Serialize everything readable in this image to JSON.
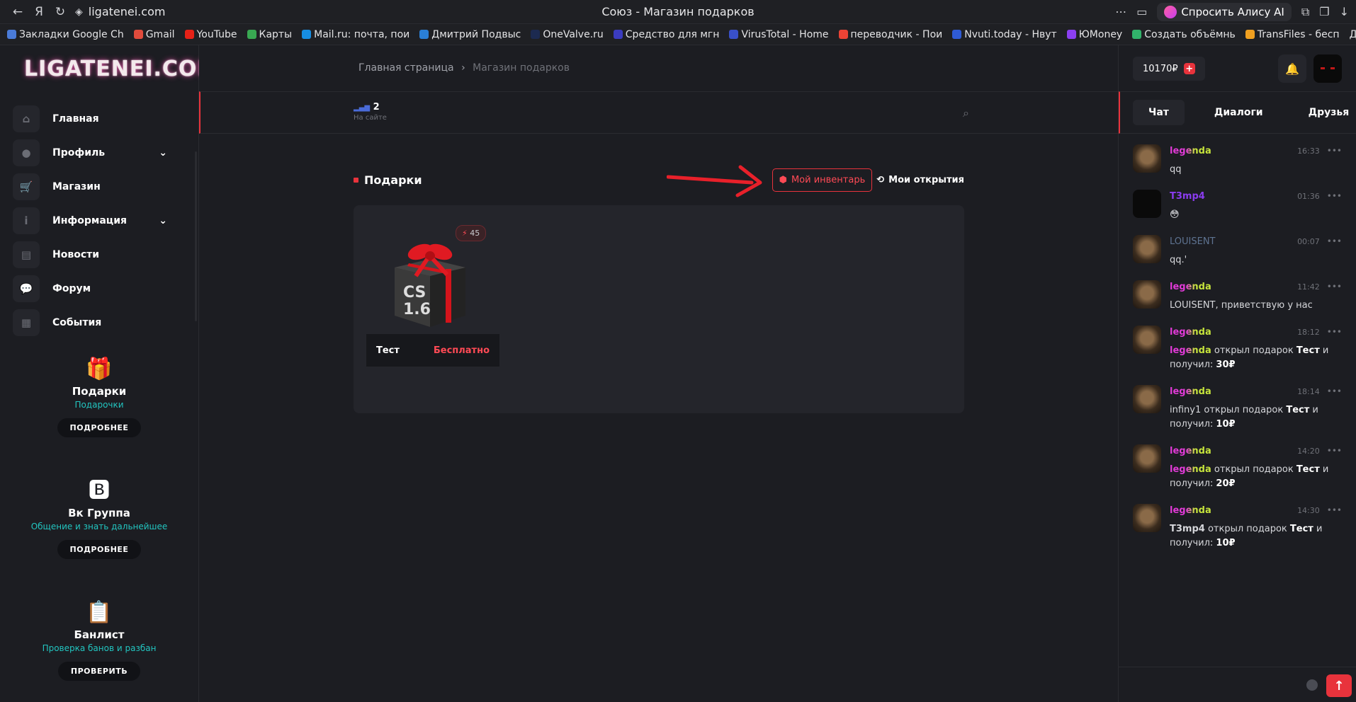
{
  "browser": {
    "url": "ligatenei.com",
    "tab_title": "Союз - Магазин подарков",
    "alice_label": "Спросить Алису AI",
    "bookmarks": [
      {
        "label": "Закладки Google Ch",
        "color": "#4a7bd8"
      },
      {
        "label": "Gmail",
        "color": "#e04b3c"
      },
      {
        "label": "YouTube",
        "color": "#e62117"
      },
      {
        "label": "Карты",
        "color": "#39a852"
      },
      {
        "label": "Mail.ru: почта, пои",
        "color": "#168de2"
      },
      {
        "label": "Дмитрий Подвыс",
        "color": "#2a7fd6"
      },
      {
        "label": "OneValve.ru",
        "color": "#1c2a50"
      },
      {
        "label": "Средство для мгн",
        "color": "#3b3cbf"
      },
      {
        "label": "VirusTotal - Home",
        "color": "#3950c8"
      },
      {
        "label": "переводчик - Пои",
        "color": "#ea4335"
      },
      {
        "label": "Nvuti.today - Нвут",
        "color": "#2f5bd6"
      },
      {
        "label": "ЮMoney",
        "color": "#8b3ff0"
      },
      {
        "label": "Создать объёмнь",
        "color": "#31b36b"
      },
      {
        "label": "TransFiles - бесп",
        "color": "#f0a020"
      }
    ],
    "other_bookmarks": "Другие закладки"
  },
  "site": {
    "logo": "LIGATENEI.COM",
    "menu": [
      {
        "label": "Главная",
        "icon": "home-icon",
        "glyph": "⌂",
        "chevron": false
      },
      {
        "label": "Профиль",
        "icon": "user-icon",
        "glyph": "●",
        "chevron": true
      },
      {
        "label": "Магазин",
        "icon": "cart-icon",
        "glyph": "🛒",
        "chevron": false
      },
      {
        "label": "Информация",
        "icon": "info-icon",
        "glyph": "i",
        "chevron": true
      },
      {
        "label": "Новости",
        "icon": "news-icon",
        "glyph": "▤",
        "chevron": false
      },
      {
        "label": "Форум",
        "icon": "forum-icon",
        "glyph": "💬",
        "chevron": false
      },
      {
        "label": "События",
        "icon": "calendar-icon",
        "glyph": "▦",
        "chevron": false
      }
    ],
    "promos": [
      {
        "title": "Подарки",
        "subtitle": "Подарочки",
        "button": "ПОДРОБНЕЕ",
        "icon": "gift-icon",
        "glyph": "🎁"
      },
      {
        "title": "Вк Группа",
        "subtitle": "Общение и знать дальнейшее",
        "button": "ПОДРОБНЕЕ",
        "icon": "vk-icon",
        "glyph": "🅱"
      },
      {
        "title": "Банлист",
        "subtitle": "Проверка банов и разбан",
        "button": "ПРОВЕРИТЬ",
        "icon": "clipboard-icon",
        "glyph": "📋"
      }
    ]
  },
  "breadcrumb": {
    "home": "Главная страница",
    "sep": "›",
    "current": "Магазин подарков"
  },
  "online": {
    "count": "2",
    "label": "На сайте"
  },
  "gifts": {
    "title": "Подарки",
    "inventory_button": "Мой инвентарь",
    "openings_button": "Мои открытия",
    "items": [
      {
        "name": "Тест",
        "price": "Бесплатно",
        "badge": "45",
        "box_text_1": "CS",
        "box_text_2": "1.6"
      }
    ]
  },
  "balance": {
    "amount": "10170₽",
    "plus": "+"
  },
  "chat_tabs": [
    "Чат",
    "Диалоги",
    "Друзья"
  ],
  "chat": [
    {
      "name": "legenda",
      "style": "legend",
      "time": "16:33",
      "text": "qq",
      "avatar": "mask"
    },
    {
      "name": "T3mp4",
      "style": "t3",
      "time": "01:36",
      "text": "😳",
      "avatar": "dark"
    },
    {
      "name": "LOUISENT",
      "style": "louis",
      "time": "00:07",
      "text": "qq.'",
      "avatar": "mask"
    },
    {
      "name": "legenda",
      "style": "legend",
      "time": "11:42",
      "text": "LOUISENT, приветствую у нас",
      "avatar": "mask"
    },
    {
      "name": "legenda",
      "style": "legend",
      "time": "18:12",
      "actor": "legenda",
      "action": " открыл подарок ",
      "gift": "Тест",
      "and": " и получил: ",
      "amount": "30₽",
      "avatar": "mask"
    },
    {
      "name": "legenda",
      "style": "legend",
      "time": "18:14",
      "actor": "infiny1",
      "action": " открыл подарок ",
      "gift": "Тест",
      "and": " и получил: ",
      "amount": "10₽",
      "avatar": "mask"
    },
    {
      "name": "legenda",
      "style": "legend",
      "time": "14:20",
      "actor": "legenda",
      "action": " открыл подарок ",
      "gift": "Тест",
      "and": " и получил: ",
      "amount": "20₽",
      "avatar": "mask"
    },
    {
      "name": "legenda",
      "style": "legend",
      "time": "14:30",
      "actor": "T3mp4",
      "action": " открыл подарок ",
      "gift": "Тест",
      "and": " и получил: ",
      "amount": "10₽",
      "avatar": "mask"
    }
  ]
}
